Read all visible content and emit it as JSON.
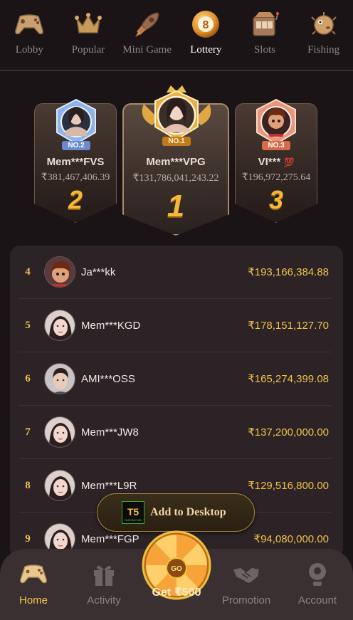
{
  "categories": [
    {
      "label": "Lobby",
      "icon": "gamepad-icon"
    },
    {
      "label": "Popular",
      "icon": "crown-icon"
    },
    {
      "label": "Mini Game",
      "icon": "rocket-icon"
    },
    {
      "label": "Lottery",
      "icon": "lottery-ball-icon",
      "active": true,
      "ball_number": "8"
    },
    {
      "label": "Slots",
      "icon": "slot-machine-icon"
    },
    {
      "label": "Fishing",
      "icon": "pufferfish-icon"
    }
  ],
  "podium": {
    "first": {
      "tag": "NO.1",
      "name": "Mem***VPG",
      "amount": "₹131,786,041,243.22",
      "rank": "1"
    },
    "second": {
      "tag": "NO.2",
      "name": "Mem***FVS",
      "amount": "₹381,467,406.39",
      "rank": "2"
    },
    "third": {
      "tag": "NO.3",
      "name": "VI***",
      "name_emoji": "💯",
      "amount": "₹196,972,275.64",
      "rank": "3"
    }
  },
  "ranking": [
    {
      "rank": "4",
      "name": "Ja***kk",
      "amount": "₹193,166,384.88",
      "avatar": "cartoon-boy"
    },
    {
      "rank": "5",
      "name": "Mem***KGD",
      "amount": "₹178,151,127.70",
      "avatar": "woman"
    },
    {
      "rank": "6",
      "name": "AMI***OSS",
      "amount": "₹165,274,399.08",
      "avatar": "man"
    },
    {
      "rank": "7",
      "name": "Mem***JW8",
      "amount": "₹137,200,000.00",
      "avatar": "woman"
    },
    {
      "rank": "8",
      "name": "Mem***L9R",
      "amount": "₹129,516,800.00",
      "avatar": "woman"
    },
    {
      "rank": "9",
      "name": "Mem***FGP",
      "amount": "₹94,080,000.00",
      "avatar": "woman"
    }
  ],
  "add_desktop": {
    "label": "Add to Desktop",
    "logo_text": "TASHAN WIN"
  },
  "bottom_nav": {
    "home": "Home",
    "activity": "Activity",
    "wheel": "Get ₹500",
    "wheel_center": "GO",
    "promotion": "Promotion",
    "account": "Account"
  },
  "colors": {
    "accent": "#f5c24a",
    "background": "#1a1416",
    "list_bg": "#2b2326",
    "nav_bg": "#3a2f31"
  }
}
